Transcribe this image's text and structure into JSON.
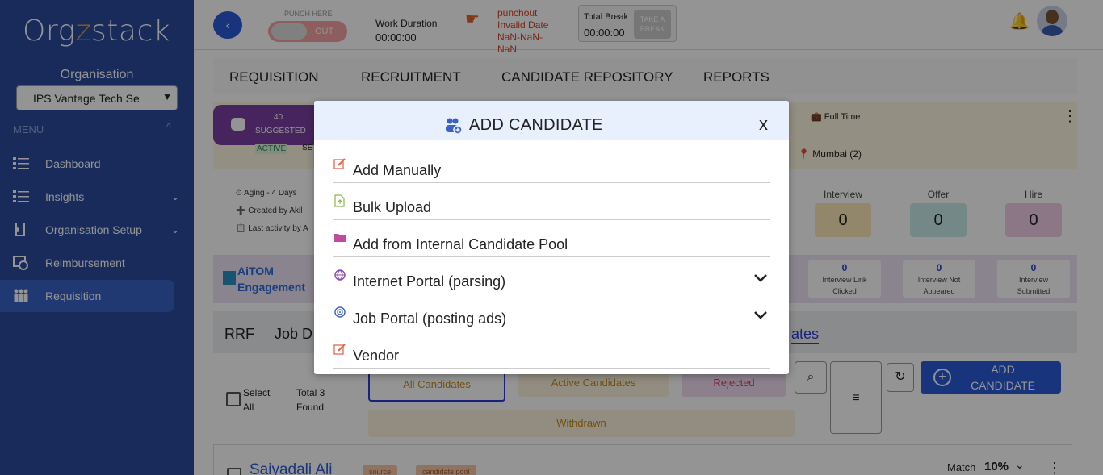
{
  "sidebar": {
    "logo_prefix": "Org",
    "logo_z": "z",
    "logo_suffix": "stack",
    "org_label": "Organisation",
    "org_selected": "IPS Vantage Tech Se",
    "menu_label": "MENU",
    "items": [
      {
        "label": "Dashboard",
        "icon": "list-icon"
      },
      {
        "label": "Insights",
        "icon": "list-icon"
      },
      {
        "label": "Organisation Setup",
        "icon": "setup-icon"
      },
      {
        "label": "Reimbursement",
        "icon": "reimbursement-icon"
      },
      {
        "label": "Requisition",
        "icon": "people-icon"
      }
    ]
  },
  "topbar": {
    "back": "‹",
    "punch_label": "PUNCH HERE",
    "punch_state": "OUT",
    "work_duration_label": "Work Duration",
    "work_duration_value": "00:00:00",
    "punchout_line1": "punchout",
    "punchout_line2": "Invalid Date",
    "punchout_line3": "NaN-NaN-",
    "punchout_line4": "NaN",
    "total_break_label": "Total Break",
    "total_break_value": "00:00:00",
    "take_break": "TAKE A BREAK"
  },
  "tabs": [
    "REQUISITION",
    "RECRUITMENT",
    "CANDIDATE REPOSITORY",
    "REPORTS"
  ],
  "req_card": {
    "suggested_count": "40",
    "suggested_label": "SUGGESTED",
    "active": "ACTIVE",
    "se": "SE",
    "full_time": "Full Time",
    "location": "Mumbai (2)"
  },
  "stats": {
    "aging": "Aging - 4 Days",
    "created_by": "Created by Akil",
    "last_activity": "Last activity by A",
    "stages": [
      {
        "label": "Interview",
        "value": "0",
        "color": "#fbe7b8"
      },
      {
        "label": "Offer",
        "value": "0",
        "color": "#c9ece8"
      },
      {
        "label": "Hire",
        "value": "0",
        "color": "#f1cde8"
      }
    ]
  },
  "aitom": {
    "line1": "AiTOM",
    "line2": "Engagement",
    "boxes": [
      {
        "count": "0",
        "label1": "Interview Link",
        "label2": "Clicked"
      },
      {
        "count": "0",
        "label1": "Interview Not",
        "label2": "Appeared"
      },
      {
        "count": "0",
        "label1": "Interview",
        "label2": "Submitted"
      }
    ]
  },
  "sub_tabs": {
    "rrf": "RRF",
    "jd": "Job D",
    "candidates": "ates"
  },
  "filters": {
    "select_all_1": "Select",
    "select_all_2": "All",
    "total_1": "Total 3",
    "total_2": "Found",
    "all_candidates": "All Candidates",
    "active_candidates": "Active Candidates",
    "rejected": "Rejected",
    "withdrawn": "Withdrawn",
    "add_candidate_1": "ADD",
    "add_candidate_2": "CANDIDATE"
  },
  "candidate": {
    "name": "Saiyadali Ali",
    "tag1": "source",
    "tag2": "candidate pool",
    "match_label": "Match",
    "match_value": "10%"
  },
  "modal": {
    "title": "ADD CANDIDATE",
    "close": "x",
    "options": [
      {
        "label": "Add Manually",
        "icon": "edit-icon",
        "expandable": false
      },
      {
        "label": "Bulk Upload",
        "icon": "file-upload-icon",
        "expandable": false
      },
      {
        "label": "Add from Internal Candidate Pool",
        "icon": "folder-icon",
        "expandable": false
      },
      {
        "label": "Internet Portal (parsing)",
        "icon": "globe-icon",
        "expandable": true
      },
      {
        "label": "Job Portal (posting ads)",
        "icon": "target-icon",
        "expandable": true
      },
      {
        "label": "Vendor",
        "icon": "edit-icon",
        "expandable": false
      }
    ]
  }
}
